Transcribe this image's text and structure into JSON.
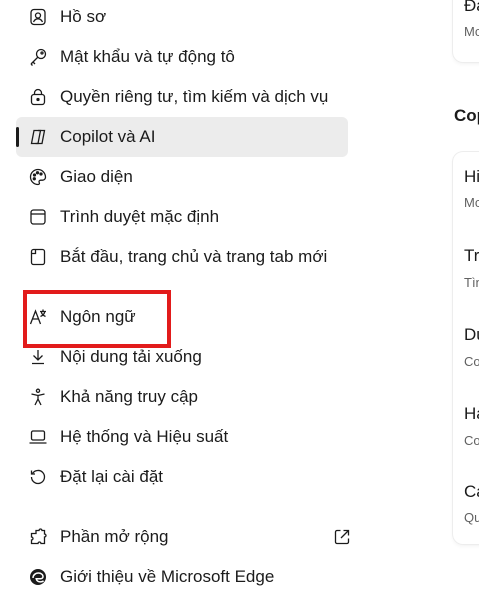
{
  "sidebar": {
    "items": [
      {
        "label": "Hồ sơ",
        "icon": "profile-icon"
      },
      {
        "label": "Mật khẩu và tự động tô",
        "icon": "key-icon"
      },
      {
        "label": "Quyền riêng tư, tìm kiếm và dịch vụ",
        "icon": "lock-icon"
      },
      {
        "label": "Copilot và AI",
        "icon": "copilot-icon",
        "active": true
      },
      {
        "label": "Giao diện",
        "icon": "palette-icon"
      },
      {
        "label": "Trình duyệt mặc định",
        "icon": "browser-icon"
      },
      {
        "label": "Bắt đầu, trang chủ và trang tab mới",
        "icon": "page-icon"
      },
      {
        "label": "Ngôn ngữ",
        "icon": "language-icon",
        "highlighted": true
      },
      {
        "label": "Nội dung tải xuống",
        "icon": "download-icon"
      },
      {
        "label": "Khả năng truy cập",
        "icon": "accessibility-icon"
      },
      {
        "label": "Hệ thống và Hiệu suất",
        "icon": "laptop-icon"
      },
      {
        "label": "Đặt lại cài đặt",
        "icon": "reset-icon"
      },
      {
        "label": "Phần mở rộng",
        "icon": "extensions-icon",
        "external": true
      },
      {
        "label": "Giới thiệu về Microsoft Edge",
        "icon": "edge-icon"
      }
    ]
  },
  "right_panel": {
    "top_card": {
      "title": "Đa",
      "subtitle": "Mc"
    },
    "section_heading": "Cop",
    "rows": [
      {
        "title": "Hi",
        "subtitle": "Mc"
      },
      {
        "title": "Tra",
        "subtitle": "Tìn"
      },
      {
        "title": "Du",
        "subtitle": "Co"
      },
      {
        "title": "Ha",
        "subtitle": "Co"
      },
      {
        "title": "Cá",
        "subtitle": "Qu"
      }
    ]
  },
  "colors": {
    "accent_highlight": "#e21b1b",
    "active_bg": "#ececec"
  }
}
